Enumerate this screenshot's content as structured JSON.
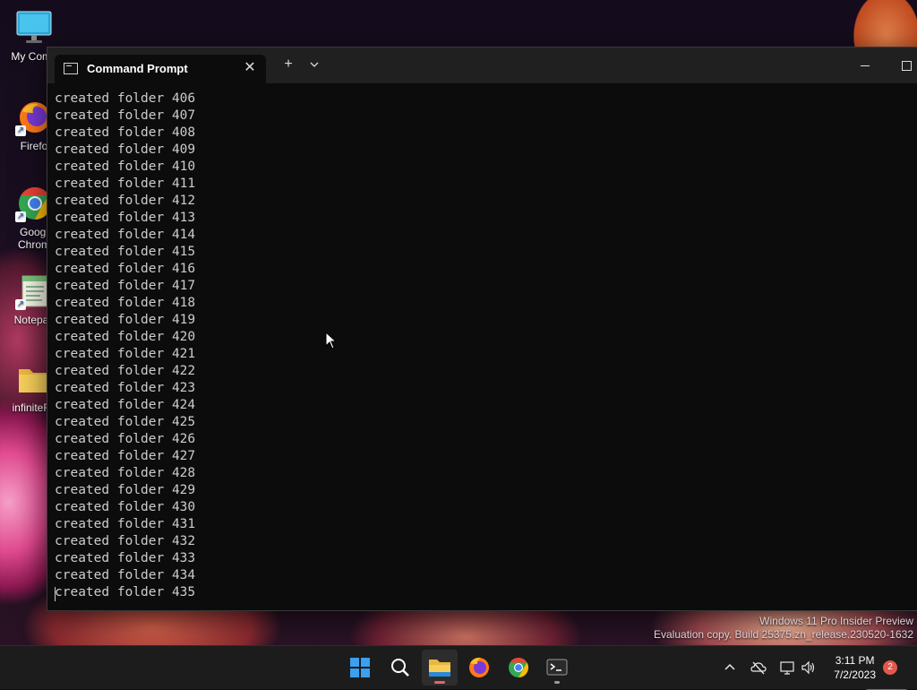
{
  "desktop": {
    "icons": [
      {
        "label": "My Comp",
        "icon": "monitor-icon"
      },
      {
        "label": "Firefo",
        "icon": "firefox-icon"
      },
      {
        "label": "Googl",
        "label2": "Chrom",
        "icon": "chrome-icon"
      },
      {
        "label": "Notepac",
        "icon": "notepad-icon"
      },
      {
        "label": "infiniteFo",
        "icon": "folder-icon"
      }
    ],
    "watermark": {
      "line1": "Windows 11 Pro Insider Preview",
      "line2": "Evaluation copy. Build 25375.zn_release.230520-1632"
    }
  },
  "window": {
    "tab_title": "Command Prompt",
    "tab_icon": "cmd-icon",
    "new_tab_symbol": "+",
    "dropdown_symbol": "⌄",
    "close_symbol": "✕",
    "console_lines": [
      "created folder 406",
      "created folder 407",
      "created folder 408",
      "created folder 409",
      "created folder 410",
      "created folder 411",
      "created folder 412",
      "created folder 413",
      "created folder 414",
      "created folder 415",
      "created folder 416",
      "created folder 417",
      "created folder 418",
      "created folder 419",
      "created folder 420",
      "created folder 421",
      "created folder 422",
      "created folder 423",
      "created folder 424",
      "created folder 425",
      "created folder 426",
      "created folder 427",
      "created folder 428",
      "created folder 429",
      "created folder 430",
      "created folder 431",
      "created folder 432",
      "created folder 433",
      "created folder 434",
      "created folder 435"
    ]
  },
  "taskbar": {
    "apps": [
      "windows-start-icon",
      "search-icon",
      "file-explorer-icon",
      "firefox-icon",
      "chrome-icon",
      "terminal-icon"
    ],
    "tray": {
      "time": "3:11 PM",
      "date": "7/2/2023",
      "notification_count": "2",
      "icons": [
        "chevron-up-icon",
        "onedrive-offline-icon",
        "network-icon",
        "volume-icon"
      ]
    }
  },
  "colors": {
    "console_bg": "#0c0c0c",
    "console_text": "#cccccc",
    "titlebar": "#202020",
    "taskbar": "#1c1c1c",
    "notification_badge": "#e0594b"
  }
}
